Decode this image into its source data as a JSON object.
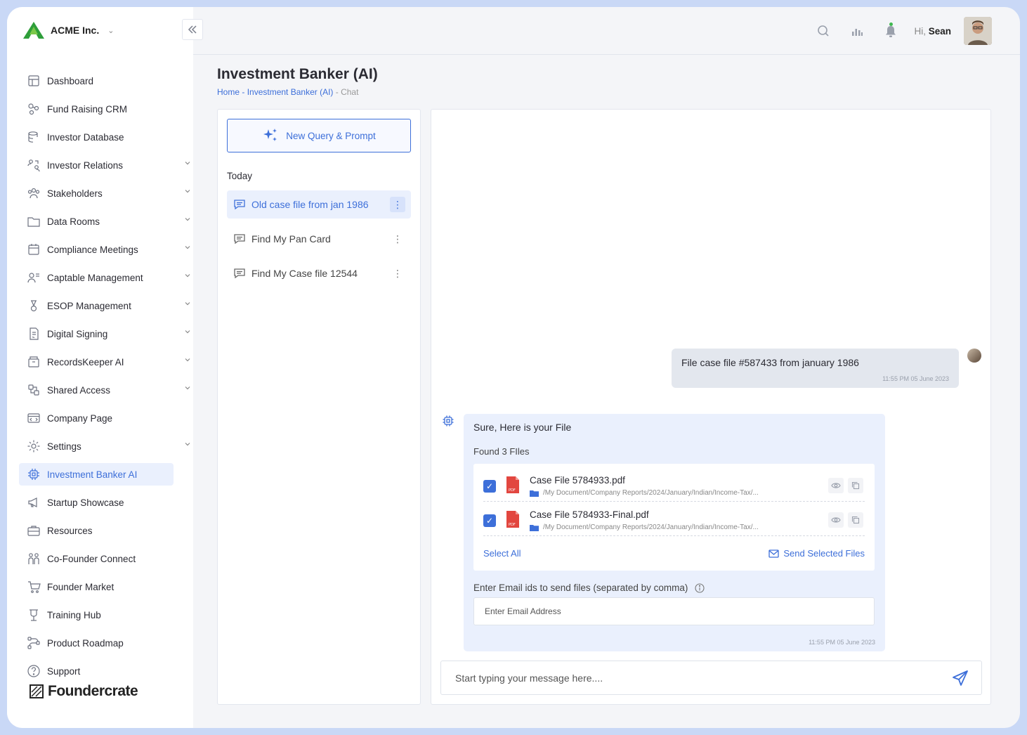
{
  "brand": {
    "name": "ACME Inc."
  },
  "nav": [
    {
      "label": "Dashboard",
      "icon": "dashboard-icon",
      "chevron": false
    },
    {
      "label": "Fund Raising CRM",
      "icon": "crm-icon",
      "chevron": false
    },
    {
      "label": "Investor Database",
      "icon": "database-icon",
      "chevron": false
    },
    {
      "label": "Investor Relations",
      "icon": "relations-icon",
      "chevron": true
    },
    {
      "label": "Stakeholders",
      "icon": "users-icon",
      "chevron": true
    },
    {
      "label": "Data Rooms",
      "icon": "folder-icon",
      "chevron": true
    },
    {
      "label": "Compliance Meetings",
      "icon": "calendar-icon",
      "chevron": true
    },
    {
      "label": "Captable Management",
      "icon": "user-list-icon",
      "chevron": true
    },
    {
      "label": "ESOP Management",
      "icon": "esop-icon",
      "chevron": true
    },
    {
      "label": "Digital Signing",
      "icon": "signing-icon",
      "chevron": true
    },
    {
      "label": "RecordsKeeper AI",
      "icon": "records-icon",
      "chevron": true
    },
    {
      "label": "Shared Access",
      "icon": "share-icon",
      "chevron": true
    },
    {
      "label": "Company Page",
      "icon": "company-page-icon",
      "chevron": false
    },
    {
      "label": "Settings",
      "icon": "gear-icon",
      "chevron": true
    },
    {
      "label": "Investment Banker AI",
      "icon": "chip-icon",
      "chevron": false,
      "active": true
    },
    {
      "label": "Startup Showcase",
      "icon": "megaphone-icon",
      "chevron": false
    },
    {
      "label": "Resources",
      "icon": "briefcase-icon",
      "chevron": false
    },
    {
      "label": "Co-Founder Connect",
      "icon": "people-icon",
      "chevron": false
    },
    {
      "label": "Founder Market",
      "icon": "cart-icon",
      "chevron": false
    },
    {
      "label": "Training Hub",
      "icon": "training-icon",
      "chevron": false
    },
    {
      "label": "Product Roadmap",
      "icon": "roadmap-icon",
      "chevron": false
    },
    {
      "label": "Support",
      "icon": "help-icon",
      "chevron": false
    }
  ],
  "footer_logo": "Foundercrate",
  "header": {
    "greeting_prefix": "Hi,",
    "user_name": "Sean"
  },
  "page": {
    "title": "Investment Banker (AI)",
    "breadcrumb": {
      "home": "Home",
      "sep1": " - ",
      "section": "Investment Banker (AI)",
      "sep2": " - ",
      "current": "Chat"
    }
  },
  "conversations": {
    "new_button": "New Query & Prompt",
    "group_label": "Today",
    "items": [
      {
        "title": "Old case file from jan 1986",
        "active": true
      },
      {
        "title": "Find My Pan Card",
        "active": false
      },
      {
        "title": "Find My Case file 12544",
        "active": false
      }
    ]
  },
  "chat": {
    "user_message": {
      "text": "File case file #587433 from january 1986",
      "timestamp": "11:55 PM 05 June 2023"
    },
    "bot_message": {
      "greeting": "Sure, Here is your File",
      "found": "Found 3 FIles",
      "files": [
        {
          "name": "Case File 5784933.pdf",
          "path": "/My Document/Company Reports/2024/January/Indian/Income-Tax/..."
        },
        {
          "name": "Case File 5784933-Final.pdf",
          "path": "/My Document/Company Reports/2024/January/Indian/Income-Tax/..."
        }
      ],
      "select_all": "Select All",
      "send_selected": "Send Selected Files",
      "email_label": "Enter Email ids to send files (separated by comma)",
      "email_placeholder": "Enter Email Address",
      "timestamp": "11:55 PM 05 June 2023"
    },
    "composer_placeholder": "Start typing your message here...."
  },
  "colors": {
    "accent": "#3d6fd9",
    "frame": "#c9d8f6",
    "brand_green": "#3fae3a"
  }
}
